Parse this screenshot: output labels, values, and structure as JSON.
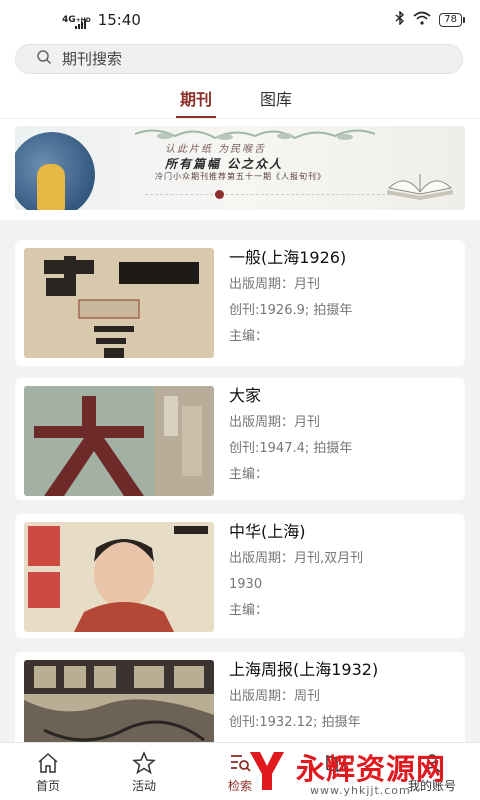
{
  "status_bar": {
    "network": "4G",
    "network_sup": "+HD",
    "time": "15:40",
    "battery": "78"
  },
  "search": {
    "placeholder": "期刊搜索"
  },
  "tabs": [
    {
      "label": "期刊",
      "active": true
    },
    {
      "label": "图库",
      "active": false
    }
  ],
  "banner": {
    "line1": "认此片纸 为民喉舌",
    "line2": "所有篇幅 公之众人",
    "line3": "冷门小众期刊推荐第五十一期《人报旬刊》"
  },
  "journals": [
    {
      "title": "一般(上海1926)",
      "meta": [
        "出版周期：月刊",
        "创刊:1926.9; 拍摄年",
        "主编："
      ]
    },
    {
      "title": "大家",
      "meta": [
        "出版周期：月刊",
        "创刊:1947.4; 拍摄年",
        "主编："
      ]
    },
    {
      "title": "中华(上海)",
      "meta": [
        "出版周期：月刊,双月刊",
        "1930",
        "主编："
      ]
    },
    {
      "title": "上海周报(上海1932)",
      "meta": [
        "出版周期：周刊",
        "创刊:1932.12; 拍摄年"
      ]
    }
  ],
  "nav": [
    {
      "label": "首页",
      "icon": "home-icon"
    },
    {
      "label": "活动",
      "icon": "star-icon"
    },
    {
      "label": "检索",
      "icon": "search-list-icon",
      "active": true
    },
    {
      "label": "",
      "icon": "book-icon"
    },
    {
      "label": "我的账号",
      "icon": "user-icon"
    }
  ],
  "watermark": {
    "text": "永辉资源网",
    "url": "www.yhkjjt.com"
  },
  "colors": {
    "accent": "#8c2f2a",
    "watermark": "#e0191f"
  }
}
